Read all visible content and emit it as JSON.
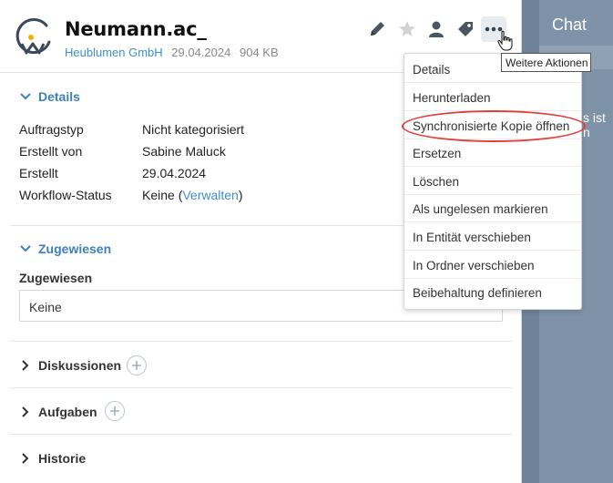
{
  "chat": {
    "title": "Chat",
    "snippet": "s ist n"
  },
  "document": {
    "title": "Neumann.ac_",
    "company": "Heublumen GmbH",
    "date": "29.04.2024",
    "size": "904 KB"
  },
  "toolbar": {
    "icons": [
      "pencil-icon",
      "star-icon",
      "person-icon",
      "tag-icon",
      "more-dots-icon"
    ],
    "tooltip": "Weitere Aktionen"
  },
  "details": {
    "heading": "Details",
    "rows": [
      {
        "label": "Auftragstyp",
        "value": "Nicht kategorisiert"
      },
      {
        "label": "Erstellt von",
        "value": "Sabine Maluck"
      },
      {
        "label": "Erstellt",
        "value": "29.04.2024"
      },
      {
        "label": "Workflow-Status",
        "value": "Keine (",
        "link": "Verwalten",
        "suffix": ")"
      }
    ]
  },
  "assigned": {
    "heading": "Zugewiesen",
    "field_label": "Zugewiesen",
    "field_value": "Keine"
  },
  "sections": {
    "discussions": "Diskussionen",
    "tasks": "Aufgaben",
    "history": "Historie"
  },
  "menu": {
    "items": [
      "Details",
      "Herunterladen",
      "Synchronisierte Kopie öffnen",
      "Ersetzen",
      "Löschen",
      "Als ungelesen markieren",
      "In Entität verschieben",
      "In Ordner verschieben",
      "Beibehaltung definieren"
    ],
    "highlighted_item": "Synchronisierte Kopie öffnen"
  },
  "colors": {
    "accent": "#3d8fd1",
    "highlight_ring": "#e0403c",
    "logo_yellow": "#f0b400"
  }
}
